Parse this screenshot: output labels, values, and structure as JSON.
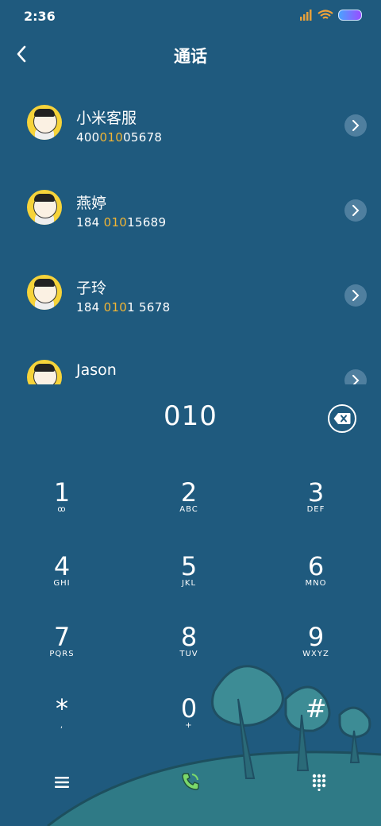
{
  "status": {
    "time": "2:36"
  },
  "header": {
    "title": "通话"
  },
  "contacts": [
    {
      "name": "小米客服",
      "number_pre": "400",
      "number_hl": "010",
      "number_post": "05678"
    },
    {
      "name": "燕婷",
      "number_pre": "184 ",
      "number_hl": "010",
      "number_post": "15689"
    },
    {
      "name": "子玲",
      "number_pre": "184 ",
      "number_hl": "010",
      "number_post": "1 5678"
    },
    {
      "name": "Jason",
      "number_pre": "",
      "number_hl": "",
      "number_post": ""
    }
  ],
  "dial": {
    "input": "010"
  },
  "keypad": [
    {
      "digit": "1",
      "letters": "ꝏ"
    },
    {
      "digit": "2",
      "letters": "ABC"
    },
    {
      "digit": "3",
      "letters": "DEF"
    },
    {
      "digit": "4",
      "letters": "GHI"
    },
    {
      "digit": "5",
      "letters": "JKL"
    },
    {
      "digit": "6",
      "letters": "MNO"
    },
    {
      "digit": "7",
      "letters": "PQRS"
    },
    {
      "digit": "8",
      "letters": "TUV"
    },
    {
      "digit": "9",
      "letters": "WXYZ"
    },
    {
      "digit": "*",
      "letters": ","
    },
    {
      "digit": "0",
      "letters": "+"
    },
    {
      "digit": "#",
      "letters": ""
    }
  ],
  "icons": {
    "back": "back-arrow-icon",
    "detail": "chevron-right-icon",
    "backspace": "backspace-icon",
    "menu": "menu-icon",
    "call": "phone-icon",
    "keypad": "dialpad-icon"
  },
  "colors": {
    "background": "#1f5a7e",
    "highlight": "#f2b534",
    "call_green": "#7bd86a"
  }
}
